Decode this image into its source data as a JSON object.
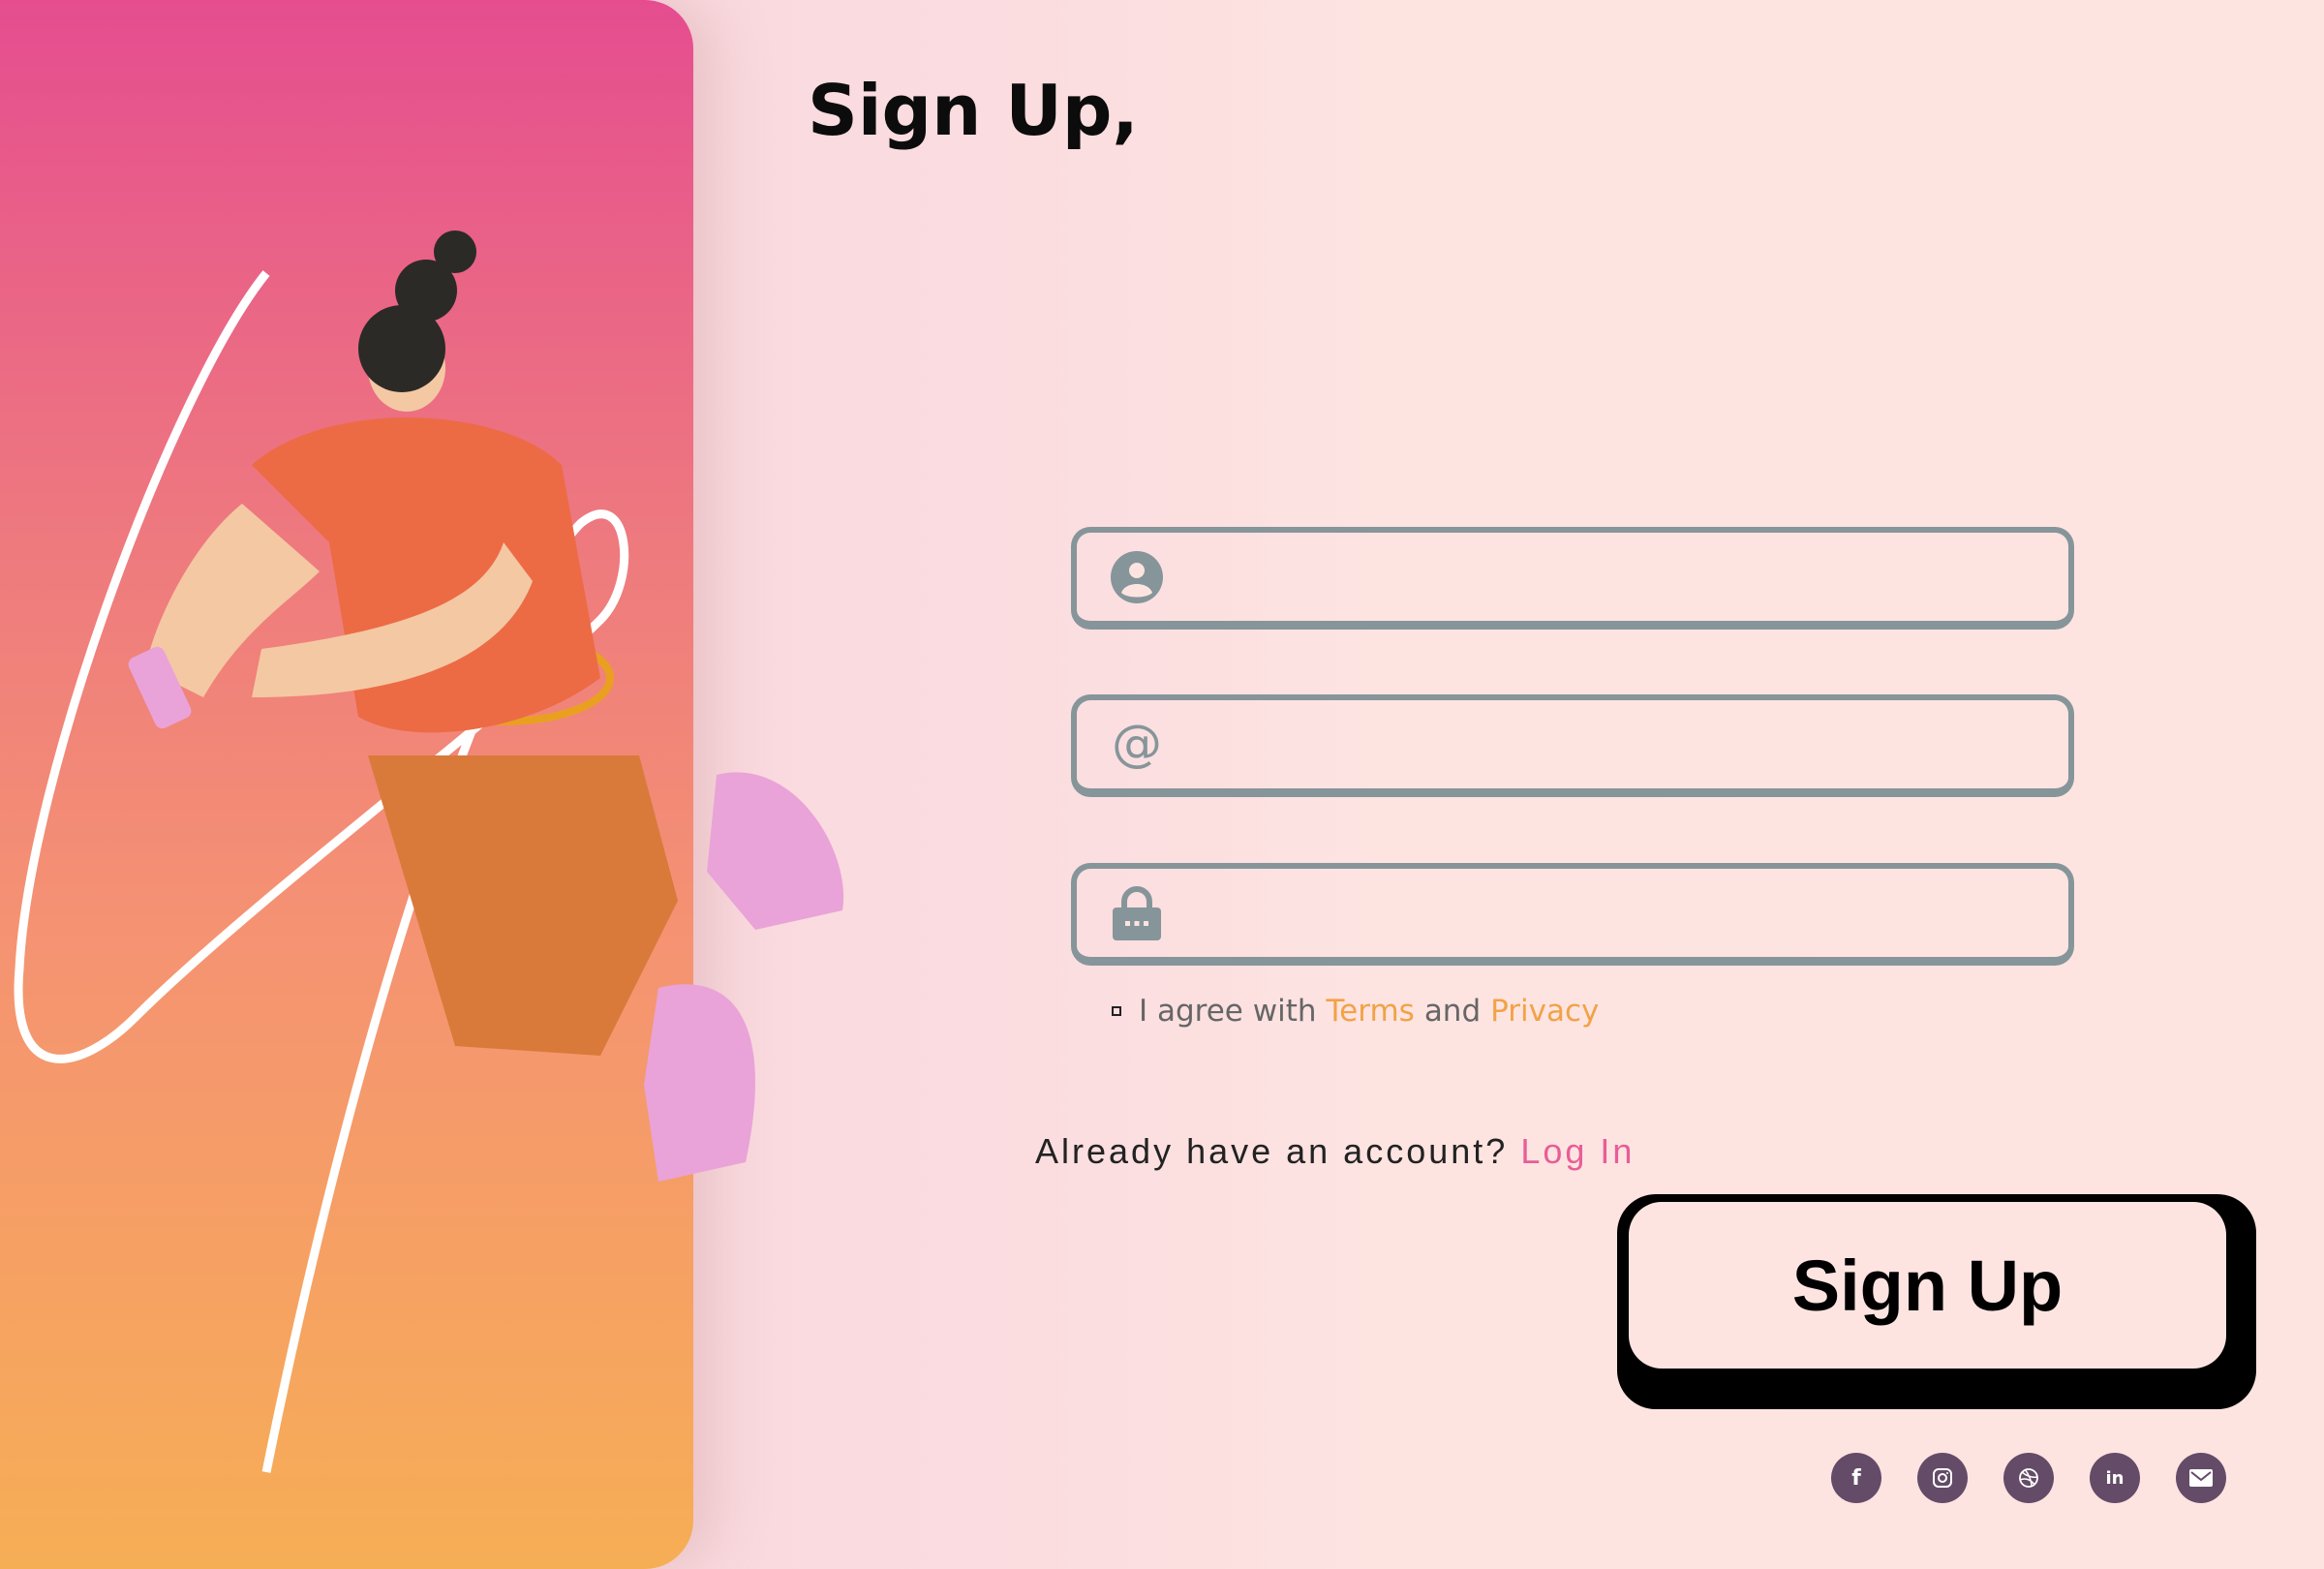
{
  "title": "Sign Up,",
  "fields": [
    {
      "icon": "user-icon",
      "placeholder": "",
      "value": ""
    },
    {
      "icon": "at-icon",
      "placeholder": "",
      "value": ""
    },
    {
      "icon": "lock-icon",
      "placeholder": "",
      "value": ""
    }
  ],
  "agree": {
    "prefix": "I agree with",
    "terms": "Terms",
    "and": "and",
    "privacy": "Privacy"
  },
  "login": {
    "prompt": "Already have an account?",
    "link": "Log In"
  },
  "submit_label": "Sign Up",
  "socials": [
    {
      "icon": "facebook-icon",
      "glyph": "f"
    },
    {
      "icon": "instagram-icon"
    },
    {
      "icon": "dribbble-icon"
    },
    {
      "icon": "linkedin-icon",
      "glyph": "in"
    },
    {
      "icon": "mail-icon"
    }
  ],
  "colors": {
    "panel_top": "#e54d8f",
    "panel_bottom": "#f6ae55",
    "field_border": "#86959a",
    "terms_link": "#f2a246",
    "login_link": "#e85d97",
    "social_bg": "#644b68"
  }
}
